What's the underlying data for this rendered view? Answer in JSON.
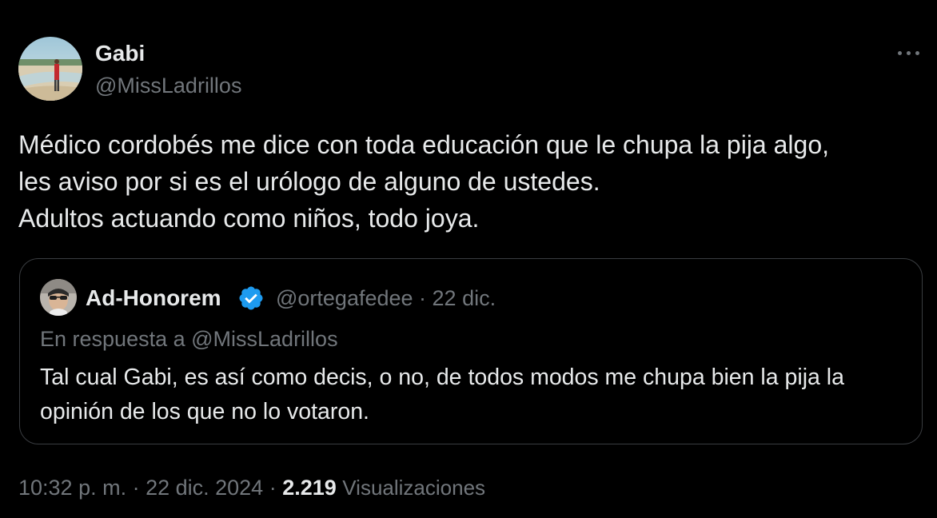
{
  "tweet": {
    "author": {
      "name": "Gabi",
      "handle": "@MissLadrillos"
    },
    "text_lines": [
      "Médico cordobés me dice con toda educación que le chupa la pija algo,",
      "les aviso por si es el urólogo de alguno de ustedes.",
      "Adultos actuando como niños, todo joya."
    ],
    "more_icon": "more-horizontal-icon",
    "timestamp": "10:32 p. m. · 22 dic. 2024",
    "separator": " · ",
    "views_count": "2.219",
    "views_label": "Visualizaciones"
  },
  "quote": {
    "author": {
      "name": "Ad-Honorem",
      "verified_icon": "verified-badge-icon",
      "handle": "@ortegafedee",
      "date": " · 22 dic."
    },
    "reply_to": "En respuesta a @MissLadrillos",
    "text_lines": [
      "Tal cual Gabi, es así como decis, o no, de todos modos me chupa bien la pija la",
      "opinión de los que no lo votaron."
    ]
  },
  "colors": {
    "background": "#000000",
    "primary_text": "#e7e9ea",
    "secondary_text": "#71767b",
    "border": "#3a3d41",
    "verified_blue": "#1d9bf0"
  }
}
